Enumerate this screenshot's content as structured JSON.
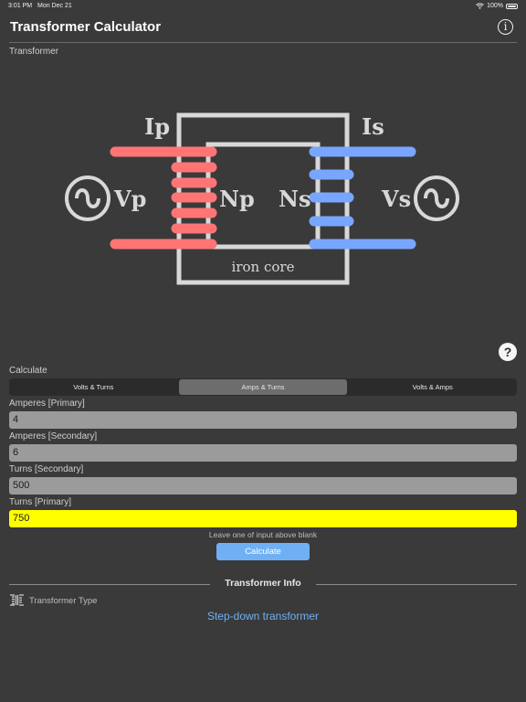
{
  "status_bar": {
    "time": "3:01 PM",
    "date": "Mon Dec 21",
    "battery": "100%"
  },
  "app": {
    "title": "Transformer Calculator"
  },
  "diagram_section": {
    "label": "Transformer"
  },
  "diagram": {
    "Ip": "Ip",
    "Is": "Is",
    "Vp": "Vp",
    "Vs": "Vs",
    "Np": "Np",
    "Ns": "Ns",
    "core_label": "iron core",
    "colors": {
      "primary": "#ff7575",
      "secondary": "#78a6ff",
      "core": "#d8d8d8"
    }
  },
  "calculate": {
    "label": "Calculate",
    "modes": [
      "Volts & Turns",
      "Amps & Turns",
      "Volts & Amps"
    ],
    "selected_mode": "Amps & Turns"
  },
  "fields": [
    {
      "label": "Amperes [Primary]",
      "value": "4"
    },
    {
      "label": "Amperes [Secondary]",
      "value": "6"
    },
    {
      "label": "Turns [Secondary]",
      "value": "500"
    },
    {
      "label": "Turns [Primary]",
      "value": "750"
    }
  ],
  "hint": "Leave one of input above blank",
  "calculate_button": "Calculate",
  "transformer_info": {
    "title": "Transformer Info",
    "type_label": "Transformer Type",
    "type_value": "Step-down transformer"
  },
  "accent_color": "#6fb0f5",
  "highlight_color": "#ffff00"
}
